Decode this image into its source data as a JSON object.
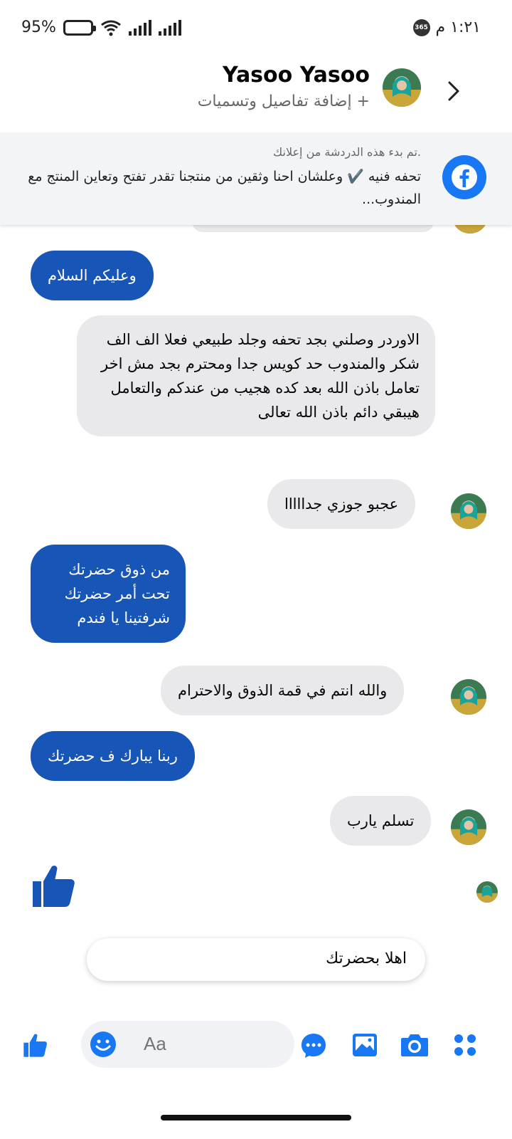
{
  "status_bar": {
    "battery": "95%",
    "time": "١:٢١ م",
    "badge": "365"
  },
  "header": {
    "contact_name": "Yasoo Yasoo",
    "add_details": "+ إضافة تفاصيل وتسميات"
  },
  "ad_banner": {
    "note": ".تم بدء هذه الدردشة من إعلانك",
    "text": "تحفه فنيه ✔️ وعلشان احنا وثقين من منتجنا تقدر تفتح وتعاين المنتج مع المندوب..."
  },
  "messages": [
    {
      "dir": "out",
      "text": "وعليكم السلام"
    },
    {
      "dir": "in",
      "text": "الاوردر وصلني بجد تحفه وجلد طبيعي فعلا الف الف شكر والمندوب حد كويس جدا ومحترم بجد مش اخر تعامل باذن الله بعد كده هجيب من عندكم والتعامل هيبقي دائم باذن الله تعالى"
    },
    {
      "dir": "in",
      "text": "عجبو جوزي جدااااا"
    },
    {
      "dir": "out",
      "lines": [
        "من ذوق حضرتك",
        "تحت أمر حضرتك",
        "شرفتينا يا فندم"
      ]
    },
    {
      "dir": "in",
      "text": "والله انتم في قمة الذوق والاحترام"
    },
    {
      "dir": "out",
      "text": "ربنا يبارك ف حضرتك"
    },
    {
      "dir": "in",
      "text": "تسلم يارب"
    }
  ],
  "suggested_reply": "اهلا بحضرتك",
  "composer": {
    "placeholder": "Aa"
  },
  "colors": {
    "outgoing_bubble": "#1755b6",
    "incoming_bubble": "#e9e9eb",
    "accent": "#1877f2"
  }
}
